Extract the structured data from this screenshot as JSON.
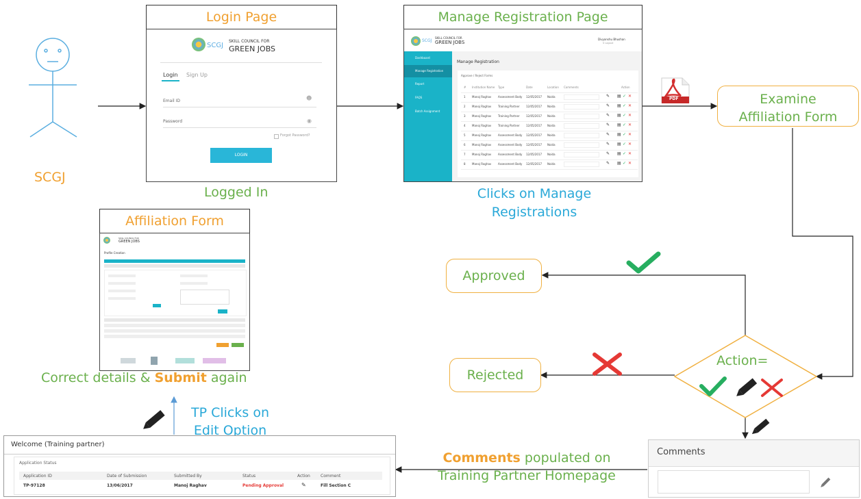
{
  "actor": {
    "label": "SCGJ"
  },
  "login": {
    "title": "Login Page",
    "caption": "Logged In",
    "brand_line1": "SKILL COUNCIL FOR",
    "brand_line2": "GREEN JOBS",
    "brand_short": "SCGJ",
    "tab_login": "Login",
    "tab_signup": "Sign Up",
    "email_placeholder": "Email ID",
    "password_placeholder": "Password",
    "forgot": "Forgot Password?",
    "button": "LOGIN"
  },
  "manage": {
    "title": "Manage Registration Page",
    "caption": "Clicks on Manage Registrations",
    "brand_line1": "SKILL COUNCIL FOR",
    "brand_line2": "GREEN JOBS",
    "brand_short": "SCGJ",
    "user_name": "Divyanshu Bhushan",
    "user_role": "S Logout",
    "sidebar": [
      "Dashboard",
      "Manage Registration",
      "Report",
      "FAQS",
      "Batch Assignment"
    ],
    "heading": "Manage Registration",
    "subheading": "Approve / Reject Forms",
    "columns": [
      "#",
      "Institution Name",
      "Type",
      "Date",
      "Location",
      "Comments",
      "Action"
    ],
    "rows": [
      {
        "n": "1",
        "name": "Manoj Raghav",
        "type": "Assessment Body",
        "date": "12/05/2017",
        "loc": "Noida"
      },
      {
        "n": "2",
        "name": "Manoj Raghav",
        "type": "Training Partner",
        "date": "12/05/2017",
        "loc": "Noida"
      },
      {
        "n": "3",
        "name": "Manoj Raghav",
        "type": "Training Partner",
        "date": "12/05/2017",
        "loc": "Noida"
      },
      {
        "n": "4",
        "name": "Manoj Raghav",
        "type": "Training Partner",
        "date": "12/05/2017",
        "loc": "Noida"
      },
      {
        "n": "5",
        "name": "Manoj Raghav",
        "type": "Assessment Body",
        "date": "12/05/2017",
        "loc": "Noida"
      },
      {
        "n": "6",
        "name": "Manoj Raghav",
        "type": "Assessment Body",
        "date": "12/05/2017",
        "loc": "Noida"
      },
      {
        "n": "7",
        "name": "Manoj Raghav",
        "type": "Assessment Body",
        "date": "12/05/2017",
        "loc": "Noida"
      },
      {
        "n": "8",
        "name": "Manoj Raghav",
        "type": "Assessment Body",
        "date": "12/05/2017",
        "loc": "Noida"
      }
    ]
  },
  "pdf_label": "PDF",
  "examine": {
    "line1": "Examine",
    "line2": "Affiliation Form"
  },
  "approved": "Approved",
  "rejected": "Rejected",
  "action": {
    "label": "Action="
  },
  "affiliation": {
    "title": "Affiliation Form",
    "caption_pre": "Correct details & ",
    "caption_bold": "Submit",
    "caption_post": " again",
    "brand_line1": "SKILL COUNCIL FOR",
    "brand_line2": "GREEN JOBS",
    "heading": "Profile Creation"
  },
  "tp_clicks": {
    "line1": "TP Clicks on",
    "line2": "Edit Option"
  },
  "comments_flow": {
    "bold": "Comments",
    "rest": " populated on",
    "line2": "Training Partner Homepage"
  },
  "comments_box": {
    "title": "Comments"
  },
  "homepage": {
    "title": "Welcome (Training partner)",
    "section": "Application Status",
    "columns": [
      "Application ID",
      "Date of Submission",
      "Submitted By",
      "Status",
      "Action",
      "Comment"
    ],
    "row": {
      "id": "TP-97128",
      "date": "13/06/2017",
      "by": "Manoj Raghav",
      "status": "Pending Approval",
      "comment": "Fill Section C"
    }
  },
  "colors": {
    "orange": "#f0a030",
    "green": "#6ab04c",
    "blue": "#29a8d8",
    "red": "#e53935",
    "teal": "#1ab3c8"
  }
}
